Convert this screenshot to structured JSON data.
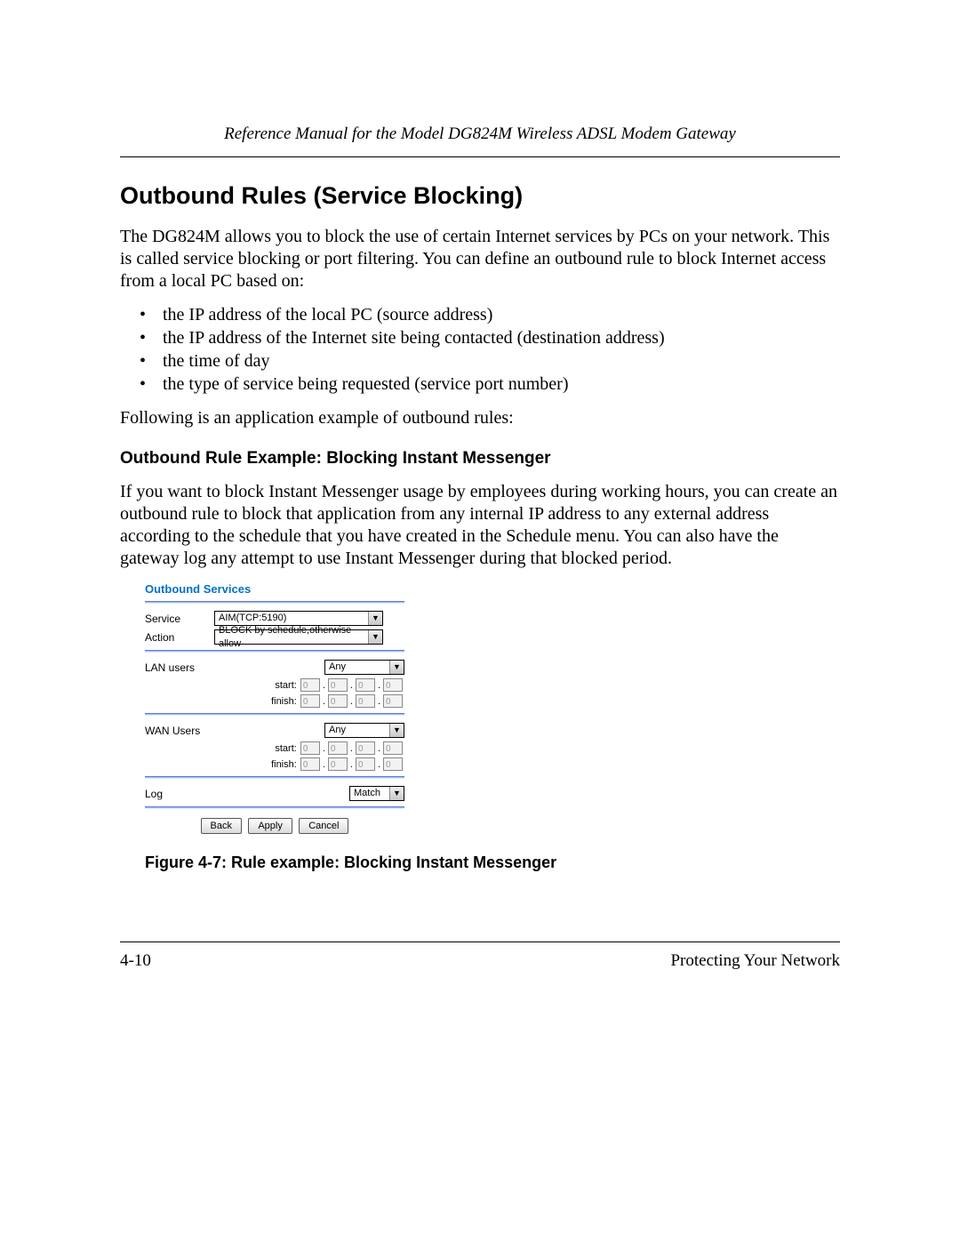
{
  "header": {
    "running_title": "Reference Manual for the Model DG824M Wireless ADSL Modem Gateway"
  },
  "section": {
    "title": "Outbound Rules (Service Blocking)",
    "intro": "The DG824M allows you to block the use of certain Internet services by PCs on your network. This is called service blocking or port filtering. You can define an outbound rule to block Internet access from a local PC based on:",
    "bullets": [
      "the IP address of the local PC (source address)",
      "the IP address of the Internet site being contacted (destination address)",
      "the time of day",
      "the type of service being requested (service port number)"
    ],
    "lead_out": "Following is an application example of outbound rules:",
    "subheading": "Outbound Rule Example: Blocking Instant Messenger",
    "example_text": "If you want to block Instant Messenger usage by employees during working hours, you can create an outbound rule to block that application from any internal IP address to any external address according to the schedule that you have created in the Schedule menu. You can also have the gateway log any attempt to use Instant Messenger during that blocked period.",
    "figure_caption": "Figure 4-7: Rule example: Blocking Instant Messenger"
  },
  "ui": {
    "panel_title": "Outbound Services",
    "labels": {
      "service": "Service",
      "action": "Action",
      "lan_users": "LAN users",
      "wan_users": "WAN Users",
      "log": "Log",
      "start": "start:",
      "finish": "finish:"
    },
    "values": {
      "service": "AIM(TCP:5190)",
      "action": "BLOCK by schedule,otherwise allow",
      "lan_scope": "Any",
      "wan_scope": "Any",
      "log": "Match",
      "octet": "0"
    },
    "buttons": {
      "back": "Back",
      "apply": "Apply",
      "cancel": "Cancel"
    }
  },
  "footer": {
    "page_number": "4-10",
    "chapter": "Protecting Your Network"
  }
}
